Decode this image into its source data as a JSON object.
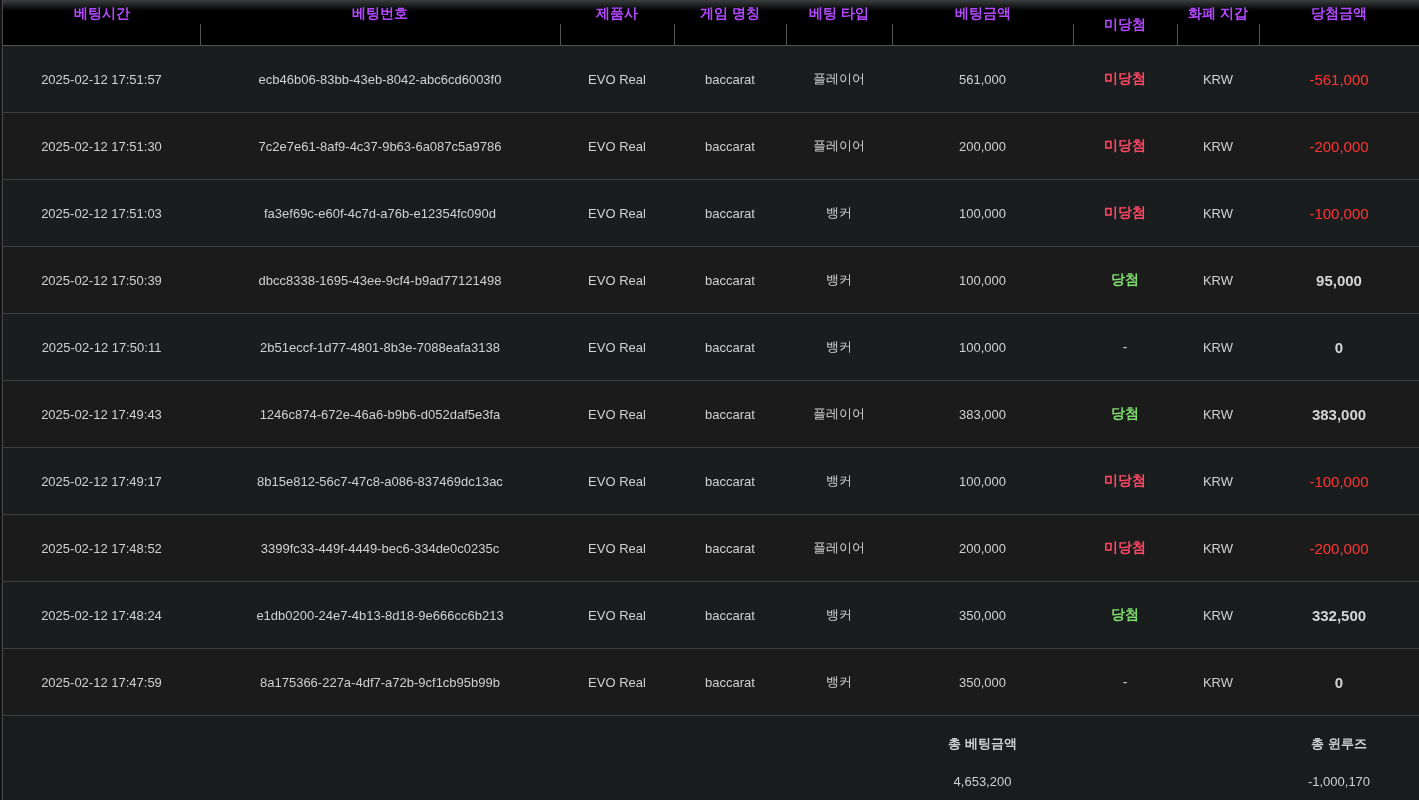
{
  "table": {
    "columns": [
      "베팅시간",
      "베팅번호",
      "제품사",
      "게임 명칭",
      "베팅 타입",
      "베팅금액",
      "미당첨",
      "화폐 지갑",
      "당첨금액"
    ],
    "rows": [
      {
        "time": "2025-02-12 17:51:57",
        "bet_id": "ecb46b06-83bb-43eb-8042-abc6cd6003f0",
        "provider": "EVO Real",
        "game": "baccarat",
        "bet_type": "플레이어",
        "bet_amount": "561,000",
        "kind": "lose",
        "result": "미당첨",
        "currency": "KRW",
        "payout": "-561,000"
      },
      {
        "time": "2025-02-12 17:51:30",
        "bet_id": "7c2e7e61-8af9-4c37-9b63-6a087c5a9786",
        "provider": "EVO Real",
        "game": "baccarat",
        "bet_type": "플레이어",
        "bet_amount": "200,000",
        "kind": "lose",
        "result": "미당첨",
        "currency": "KRW",
        "payout": "-200,000"
      },
      {
        "time": "2025-02-12 17:51:03",
        "bet_id": "fa3ef69c-e60f-4c7d-a76b-e12354fc090d",
        "provider": "EVO Real",
        "game": "baccarat",
        "bet_type": "뱅커",
        "bet_amount": "100,000",
        "kind": "lose",
        "result": "미당첨",
        "currency": "KRW",
        "payout": "-100,000"
      },
      {
        "time": "2025-02-12 17:50:39",
        "bet_id": "dbcc8338-1695-43ee-9cf4-b9ad77121498",
        "provider": "EVO Real",
        "game": "baccarat",
        "bet_type": "뱅커",
        "bet_amount": "100,000",
        "kind": "win",
        "result": "당첨",
        "currency": "KRW",
        "payout": "95,000"
      },
      {
        "time": "2025-02-12 17:50:11",
        "bet_id": "2b51eccf-1d77-4801-8b3e-7088eafa3138",
        "provider": "EVO Real",
        "game": "baccarat",
        "bet_type": "뱅커",
        "bet_amount": "100,000",
        "kind": "none",
        "result": "-",
        "currency": "KRW",
        "payout": "0"
      },
      {
        "time": "2025-02-12 17:49:43",
        "bet_id": "1246c874-672e-46a6-b9b6-d052daf5e3fa",
        "provider": "EVO Real",
        "game": "baccarat",
        "bet_type": "플레이어",
        "bet_amount": "383,000",
        "kind": "win",
        "result": "당첨",
        "currency": "KRW",
        "payout": "383,000"
      },
      {
        "time": "2025-02-12 17:49:17",
        "bet_id": "8b15e812-56c7-47c8-a086-837469dc13ac",
        "provider": "EVO Real",
        "game": "baccarat",
        "bet_type": "뱅커",
        "bet_amount": "100,000",
        "kind": "lose",
        "result": "미당첨",
        "currency": "KRW",
        "payout": "-100,000"
      },
      {
        "time": "2025-02-12 17:48:52",
        "bet_id": "3399fc33-449f-4449-bec6-334de0c0235c",
        "provider": "EVO Real",
        "game": "baccarat",
        "bet_type": "플레이어",
        "bet_amount": "200,000",
        "kind": "lose",
        "result": "미당첨",
        "currency": "KRW",
        "payout": "-200,000"
      },
      {
        "time": "2025-02-12 17:48:24",
        "bet_id": "e1db0200-24e7-4b13-8d18-9e666cc6b213",
        "provider": "EVO Real",
        "game": "baccarat",
        "bet_type": "뱅커",
        "bet_amount": "350,000",
        "kind": "win",
        "result": "당첨",
        "currency": "KRW",
        "payout": "332,500"
      },
      {
        "time": "2025-02-12 17:47:59",
        "bet_id": "8a175366-227a-4df7-a72b-9cf1cb95b99b",
        "provider": "EVO Real",
        "game": "baccarat",
        "bet_type": "뱅커",
        "bet_amount": "350,000",
        "kind": "none",
        "result": "-",
        "currency": "KRW",
        "payout": "0"
      }
    ]
  },
  "summary": [
    {
      "label": "총 베팅금액",
      "value": "4,653,200"
    },
    {
      "label": "총 윈루즈",
      "value": "-1,000,170"
    }
  ]
}
